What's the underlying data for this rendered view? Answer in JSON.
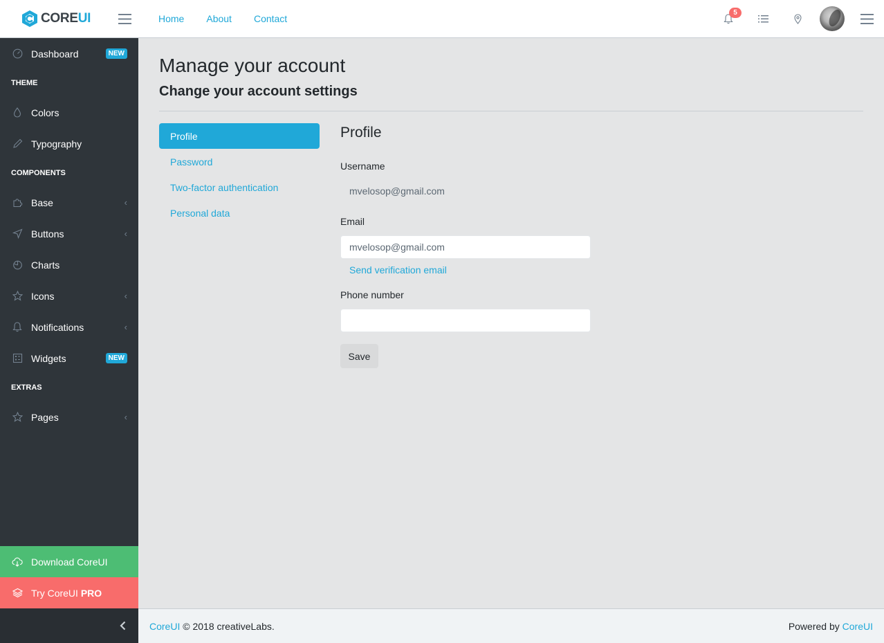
{
  "brand": {
    "name_core": "CORE",
    "name_ui": "UI"
  },
  "header": {
    "nav": [
      "Home",
      "About",
      "Contact"
    ],
    "notifications_count": "5"
  },
  "sidebar": {
    "dashboard": {
      "label": "Dashboard",
      "badge": "NEW"
    },
    "theme_title": "THEME",
    "colors": "Colors",
    "typography": "Typography",
    "components_title": "COMPONENTS",
    "base": "Base",
    "buttons": "Buttons",
    "charts": "Charts",
    "icons": "Icons",
    "notifications": "Notifications",
    "widgets": {
      "label": "Widgets",
      "badge": "NEW"
    },
    "extras_title": "EXTRAS",
    "pages": "Pages",
    "download": "Download CoreUI",
    "try_prefix": "Try CoreUI ",
    "try_bold": "PRO"
  },
  "main": {
    "title": "Manage your account",
    "subtitle": "Change your account settings",
    "pills": [
      "Profile",
      "Password",
      "Two-factor authentication",
      "Personal data"
    ],
    "form": {
      "title": "Profile",
      "username_label": "Username",
      "username_value": "mvelosop@gmail.com",
      "email_label": "Email",
      "email_value": "mvelosop@gmail.com",
      "send_verification": "Send verification email",
      "phone_label": "Phone number",
      "phone_value": "",
      "save": "Save"
    }
  },
  "footer": {
    "left_link": "CoreUI",
    "left_text": " © 2018 creativeLabs.",
    "right_text": "Powered by ",
    "right_link": "CoreUI"
  },
  "colors": {
    "primary": "#20a8d8",
    "sidebar_bg": "#2f353a",
    "success": "#4dbd74",
    "danger": "#f86c6b"
  }
}
